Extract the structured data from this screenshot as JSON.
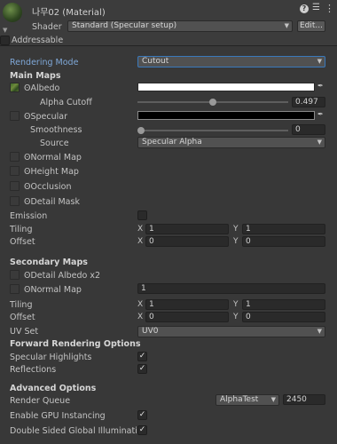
{
  "header": {
    "title": "나무02 (Material)",
    "shader_label": "Shader",
    "shader_value": "Standard (Specular setup)",
    "edit_button": "Edit...",
    "addressable_label": "Addressable",
    "help_icon": "help-icon",
    "preset_icon": "sliders-icon",
    "menu_icon": "kebab-menu-icon"
  },
  "rendering": {
    "mode_label": "Rendering Mode",
    "mode_value": "Cutout"
  },
  "main_maps": {
    "heading": "Main Maps",
    "albedo": "Albedo",
    "alpha_cutoff_label": "Alpha Cutoff",
    "alpha_cutoff_value": "0.497",
    "alpha_cutoff_fraction": 0.497,
    "specular": "Specular",
    "smoothness_label": "Smoothness",
    "smoothness_value": "0",
    "smoothness_fraction": 0,
    "source_label": "Source",
    "source_value": "Specular Alpha",
    "normal_map": "Normal Map",
    "height_map": "Height Map",
    "occlusion": "Occlusion",
    "detail_mask": "Detail Mask",
    "emission": "Emission",
    "tiling_label": "Tiling",
    "tiling_x": "1",
    "tiling_y": "1",
    "offset_label": "Offset",
    "offset_x": "0",
    "offset_y": "0",
    "x_axis": "X",
    "y_axis": "Y",
    "albedo_color": "#ffffff",
    "specular_color": "#000000"
  },
  "secondary_maps": {
    "heading": "Secondary Maps",
    "detail_albedo": "Detail Albedo x2",
    "normal_map": "Normal Map",
    "normal_scale": "1",
    "tiling_label": "Tiling",
    "tiling_x": "1",
    "tiling_y": "1",
    "offset_label": "Offset",
    "offset_x": "0",
    "offset_y": "0",
    "uv_set_label": "UV Set",
    "uv_set_value": "UV0"
  },
  "forward": {
    "heading": "Forward Rendering Options",
    "specular_highlights": "Specular Highlights",
    "reflections": "Reflections",
    "check_glyph": "✓"
  },
  "advanced": {
    "heading": "Advanced Options",
    "render_queue_label": "Render Queue",
    "render_queue_mode": "AlphaTest",
    "render_queue_value": "2450",
    "gpu_instancing": "Enable GPU Instancing",
    "double_sided_gi": "Double Sided Global Illumination"
  }
}
